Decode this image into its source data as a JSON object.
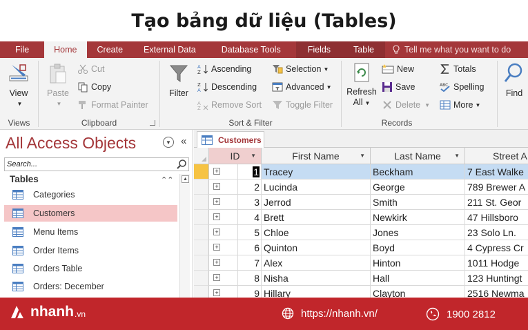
{
  "heading": "Tạo bảng dữ liệu (Tables)",
  "ribbon_tabs": [
    "File",
    "Home",
    "Create",
    "External Data",
    "Database Tools",
    "Fields",
    "Table"
  ],
  "tell_me": "Tell me what you want to do",
  "ribbon": {
    "views": {
      "view": "View",
      "label": "Views"
    },
    "clipboard": {
      "paste": "Paste",
      "cut": "Cut",
      "copy": "Copy",
      "format_painter": "Format Painter",
      "label": "Clipboard"
    },
    "sort_filter": {
      "filter": "Filter",
      "ascending": "Ascending",
      "descending": "Descending",
      "remove_sort": "Remove Sort",
      "selection": "Selection",
      "advanced": "Advanced",
      "toggle_filter": "Toggle Filter",
      "label": "Sort & Filter"
    },
    "records": {
      "refresh": "Refresh",
      "all": "All",
      "new": "New",
      "save": "Save",
      "delete": "Delete",
      "totals": "Totals",
      "spelling": "Spelling",
      "more": "More",
      "label": "Records"
    },
    "find": {
      "find": "Find"
    }
  },
  "nav": {
    "title": "All Access Objects",
    "search_placeholder": "Search...",
    "group": "Tables",
    "items": [
      "Categories",
      "Customers",
      "Menu Items",
      "Order Items",
      "Orders Table",
      "Orders: December"
    ],
    "selected": "Customers"
  },
  "doc_tab": "Customers",
  "table": {
    "columns": [
      "ID",
      "First Name",
      "Last Name",
      "Street A"
    ],
    "rows": [
      [
        "1",
        "Tracey",
        "Beckham",
        "7 East Walke"
      ],
      [
        "2",
        "Lucinda",
        "George",
        "789 Brewer A"
      ],
      [
        "3",
        "Jerrod",
        "Smith",
        "211 St. Geor"
      ],
      [
        "4",
        "Brett",
        "Newkirk",
        "47 Hillsboro"
      ],
      [
        "5",
        "Chloe",
        "Jones",
        "23 Solo Ln."
      ],
      [
        "6",
        "Quinton",
        "Boyd",
        "4 Cypress Cr"
      ],
      [
        "7",
        "Alex",
        "Hinton",
        "1011 Hodge"
      ],
      [
        "8",
        "Nisha",
        "Hall",
        "123 Huntingt"
      ],
      [
        "9",
        "Hillary",
        "Clayton",
        "2516 Newma"
      ]
    ]
  },
  "footer": {
    "brand": "nhanh",
    "brand_suffix": ".vn",
    "website": "https://nhanh.vn/",
    "phone": "1900 2812"
  },
  "colors": {
    "access_red": "#a4373a",
    "footer_red": "#c1262b",
    "selected_row": "#c5dcf3",
    "selected_nav": "#f5c6c7"
  }
}
